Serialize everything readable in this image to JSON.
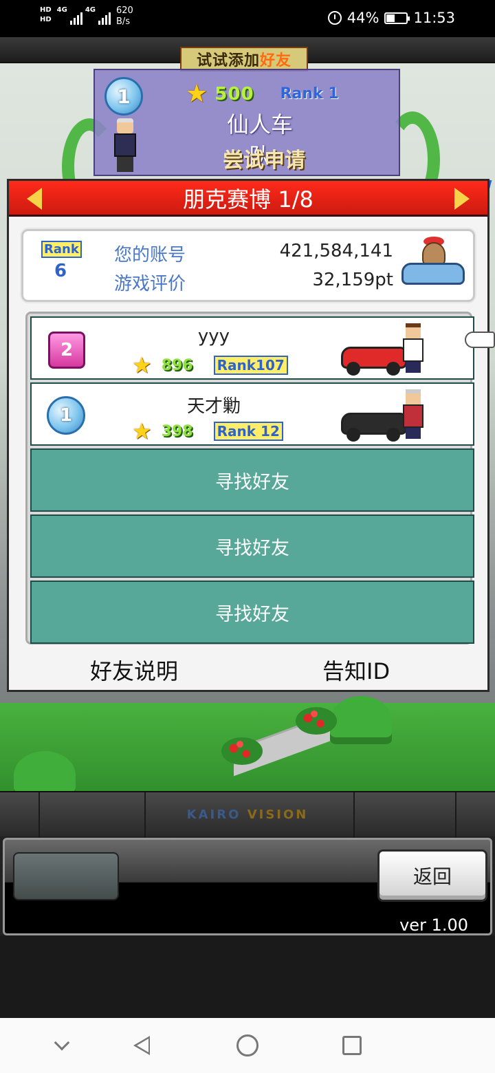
{
  "status_bar": {
    "hd1": "HD",
    "hd2": "HD",
    "net1": "4G",
    "net2": "4G",
    "speed_value": "620",
    "speed_unit": "B/s",
    "battery": "44%",
    "battery_level": 0.44,
    "time": "11:53"
  },
  "top_card": {
    "banner_prefix": "试试添加",
    "banner_highlight": "好友",
    "rank_number": "1",
    "stars": "500",
    "rank_label": "Rank",
    "rank_value": "1",
    "team_name": "仙人车队",
    "action": "尝试申请"
  },
  "panel": {
    "title": "朋克赛博 1/8",
    "account": {
      "rank_label": "Rank",
      "rank_value": "6",
      "id_label": "您的账号",
      "id_value": "421,584,141",
      "rating_label": "游戏评价",
      "rating_value": "32,159pt"
    },
    "friends": [
      {
        "rank_badge": "2",
        "name": "yyy",
        "stars": "896",
        "rank_text": "Rank107",
        "car_color": "#e02a2a"
      },
      {
        "rank_badge": "1",
        "name": "天才勦",
        "stars": "398",
        "rank_label": "Rank",
        "rank_value": "12",
        "car_color": "#2b2b2b"
      }
    ],
    "find_slots": [
      "寻找好友",
      "寻找好友",
      "寻找好友"
    ],
    "footer": {
      "help": "好友说明",
      "share_id": "告知ID"
    }
  },
  "hud": {
    "brand_a": "KAIRO",
    "brand_b": "VISION",
    "back": "返回",
    "version": "ver 1.00"
  },
  "colors": {
    "header_red": "#ff2b1a",
    "find_teal": "#58a89a",
    "arrow_yellow": "#f7d34a"
  }
}
